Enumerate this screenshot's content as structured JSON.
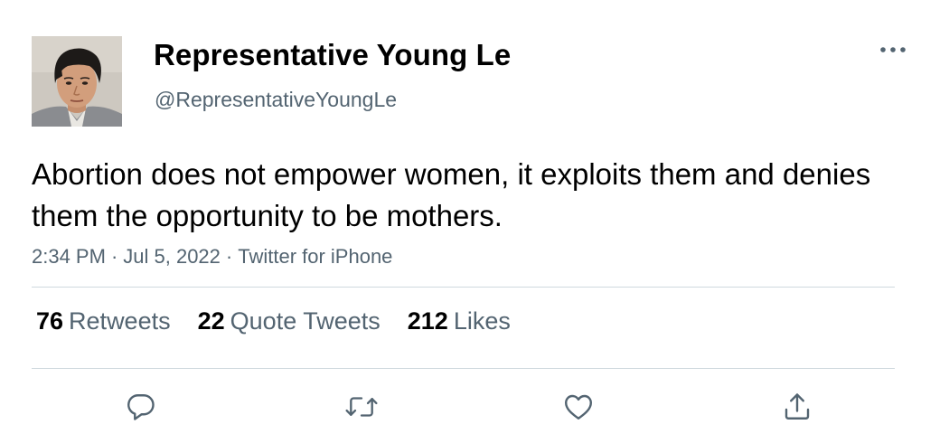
{
  "tweet": {
    "author": {
      "display_name": "Representative Young Le",
      "handle": "@RepresentativeYoungLe"
    },
    "text": "Abortion does not empower women, it exploits them and denies them the opportunity to be mothers.",
    "meta": {
      "time": "2:34 PM",
      "date": "Jul 5, 2022",
      "source": "Twitter for iPhone",
      "separator": "·"
    },
    "stats": [
      {
        "count": "76",
        "label": "Retweets"
      },
      {
        "count": "22",
        "label": "Quote Tweets"
      },
      {
        "count": "212",
        "label": "Likes"
      }
    ],
    "actions": [
      "reply-icon",
      "retweet-icon",
      "like-icon",
      "share-icon"
    ],
    "colors": {
      "text": "#000000",
      "secondary_text": "#536471",
      "divider": "#cfd9de",
      "icon": "#536471"
    }
  }
}
